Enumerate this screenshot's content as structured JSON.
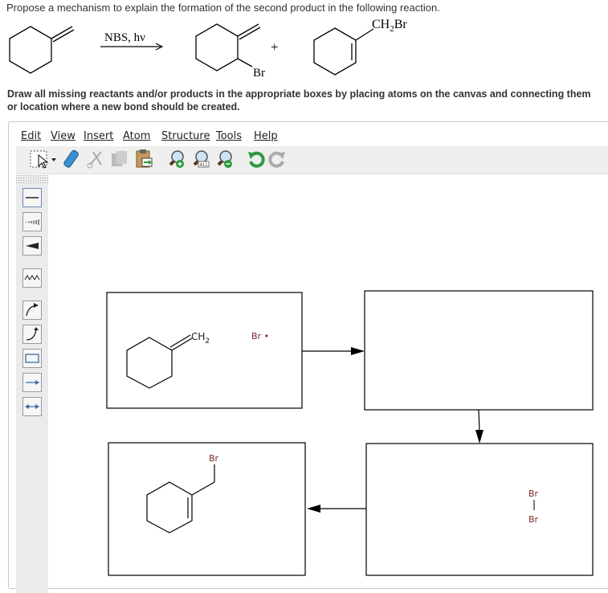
{
  "question": "Propose a mechanism to explain the formation of the second product in the following reaction.",
  "reaction": {
    "reagent": "NBS, hν",
    "plus": "+",
    "product1_substituent": "Br",
    "product2_substituent_main": "CH",
    "product2_substituent_sub": "2",
    "product2_substituent_end": "Br"
  },
  "instruction_line1": "Draw all missing reactants and/or products in the appropriate boxes by placing atoms on the canvas and connecting them",
  "instruction_line2": "or location where a new bond should be created.",
  "menu": [
    "Edit",
    "View",
    "Insert",
    "Atom",
    "Structure",
    "Tools",
    "Help"
  ],
  "toolbar_icons": [
    "select-tool-icon",
    "eraser-icon",
    "cut-icon",
    "copy-icon",
    "paste-icon",
    "zoom-in-icon",
    "zoom-all-icon",
    "zoom-out-icon",
    "undo-icon",
    "redo-icon"
  ],
  "left_tools": [
    "single-bond-icon",
    "hashed-bond-icon",
    "wedge-bond-icon",
    "wavy-bond-icon",
    "curved-arrow-full-icon",
    "curved-arrow-half-icon",
    "rectangle-icon",
    "reaction-arrow-icon",
    "resonance-arrow-icon"
  ],
  "canvas": {
    "box1": {
      "ch_main": "CH",
      "ch_sub": "2",
      "radical": "Br •"
    },
    "box3": {
      "br_top": "Br",
      "br_bottom": "Br"
    },
    "box4": {
      "br": "Br"
    }
  },
  "colors": {
    "atom_label": "#7b2b2b",
    "toolbar_bg": "#efefef"
  }
}
